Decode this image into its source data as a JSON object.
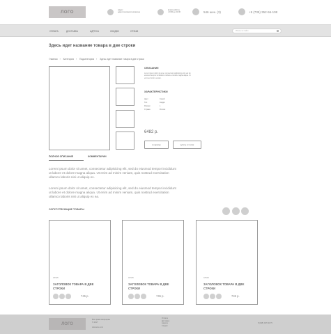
{
  "colors": {
    "header_bg": "#ffffff",
    "nav_bg": "#e3e3e3",
    "footer_bg": "#cfcfcf",
    "placeholder_gray": "#c9c6c6",
    "border": "#9c9c9c"
  },
  "header": {
    "logo": "ЛОГО",
    "address_line1": "Адрес",
    "address_line2": "адрес основного магазина",
    "hours_line1": "время работы",
    "hours_line2": "с 9:00 до 21:00",
    "cart": "546 шек. (3)",
    "phone": "+9 (735) 352-56-108"
  },
  "nav": {
    "items": [
      "ОПЛАТА",
      "ДОСТАВКА",
      "АДРЕСА",
      "СКИДКИ",
      "ОТЗЫВ"
    ],
    "search_placeholder": "Искать на сайте"
  },
  "product": {
    "title": "Здесь идет название товара в две строки",
    "breadcrumb": [
      "Главная",
      "Категория",
      "Подкатегория",
      "Здесь идет название товара в две строки"
    ],
    "description_title": "ОПИСАНИЕ",
    "description_text": "Lorem ipsum dolor sit amet, consectetur adipisicing elit, sed do eiusmod tempor incididunt ut labore et dolore magna aliqua. Ut enim ad minim veniam.",
    "characteristics_title": "ХАРАКТЕРИСТИКИ",
    "characteristics": [
      {
        "name": "Цвет",
        "value": "Синий"
      },
      {
        "name": "Тип",
        "value": "Кардиг"
      },
      {
        "name": "Размер",
        "value": "L"
      },
      {
        "name": "Страна",
        "value": "Россия"
      }
    ],
    "price": "6482 р.",
    "add_to_cart": "в корзину",
    "buy_one_click": "купить в 1 клик"
  },
  "tabs": {
    "full_description": "ПОЛНОЕ ОПИСАНИЕ",
    "comments": "КОММЕНТАРИИ",
    "paragraph1": "Lorem ipsum dolor sit amet, consectetur adipisicing elit, sed do eiusmod tempor incididunt ut labore et dolore magna aliqua. Ut enim ad minim veniam, quis nostrud exercitation ullamco laboris nisi ut aliquip ex.",
    "paragraph2": "Lorem ipsum dolor sit amet, consectetur adipisicing elit, sed do eiusmod tempor incididunt ut labore et dolore magna aliqua. Ut enim ad minim veniam, quis nostrud exercitation ullamco laboris nisi ut aliquip ex ea."
  },
  "related": {
    "title": "СОПУТСТВУЮЩИЕ ТОВАРЫ",
    "cards": [
      {
        "brand": "СТИЛ",
        "title": "ЗАГОЛОВОК ТОВАРА В ДВЕ СТРОКИ",
        "price": "745 р."
      },
      {
        "brand": "СТИЛ",
        "title": "ЗАГОЛОВОК ТОВАРА В ДВЕ СТРОКИ",
        "price": "745 р."
      },
      {
        "brand": "СТИЛ",
        "title": "ЗАГОЛОВОК ТОВАРА В ДВЕ СТРОКИ",
        "price": "745 р."
      }
    ]
  },
  "footer": {
    "logo": "ЛОГО",
    "info_line1": "Все права защищены",
    "info_line2": "© 2017",
    "site": "sitename.com",
    "links": [
      "Оплата",
      "Доставка",
      "Адреса",
      "Скидки"
    ],
    "phone": "8 (495) 927-60-75"
  }
}
